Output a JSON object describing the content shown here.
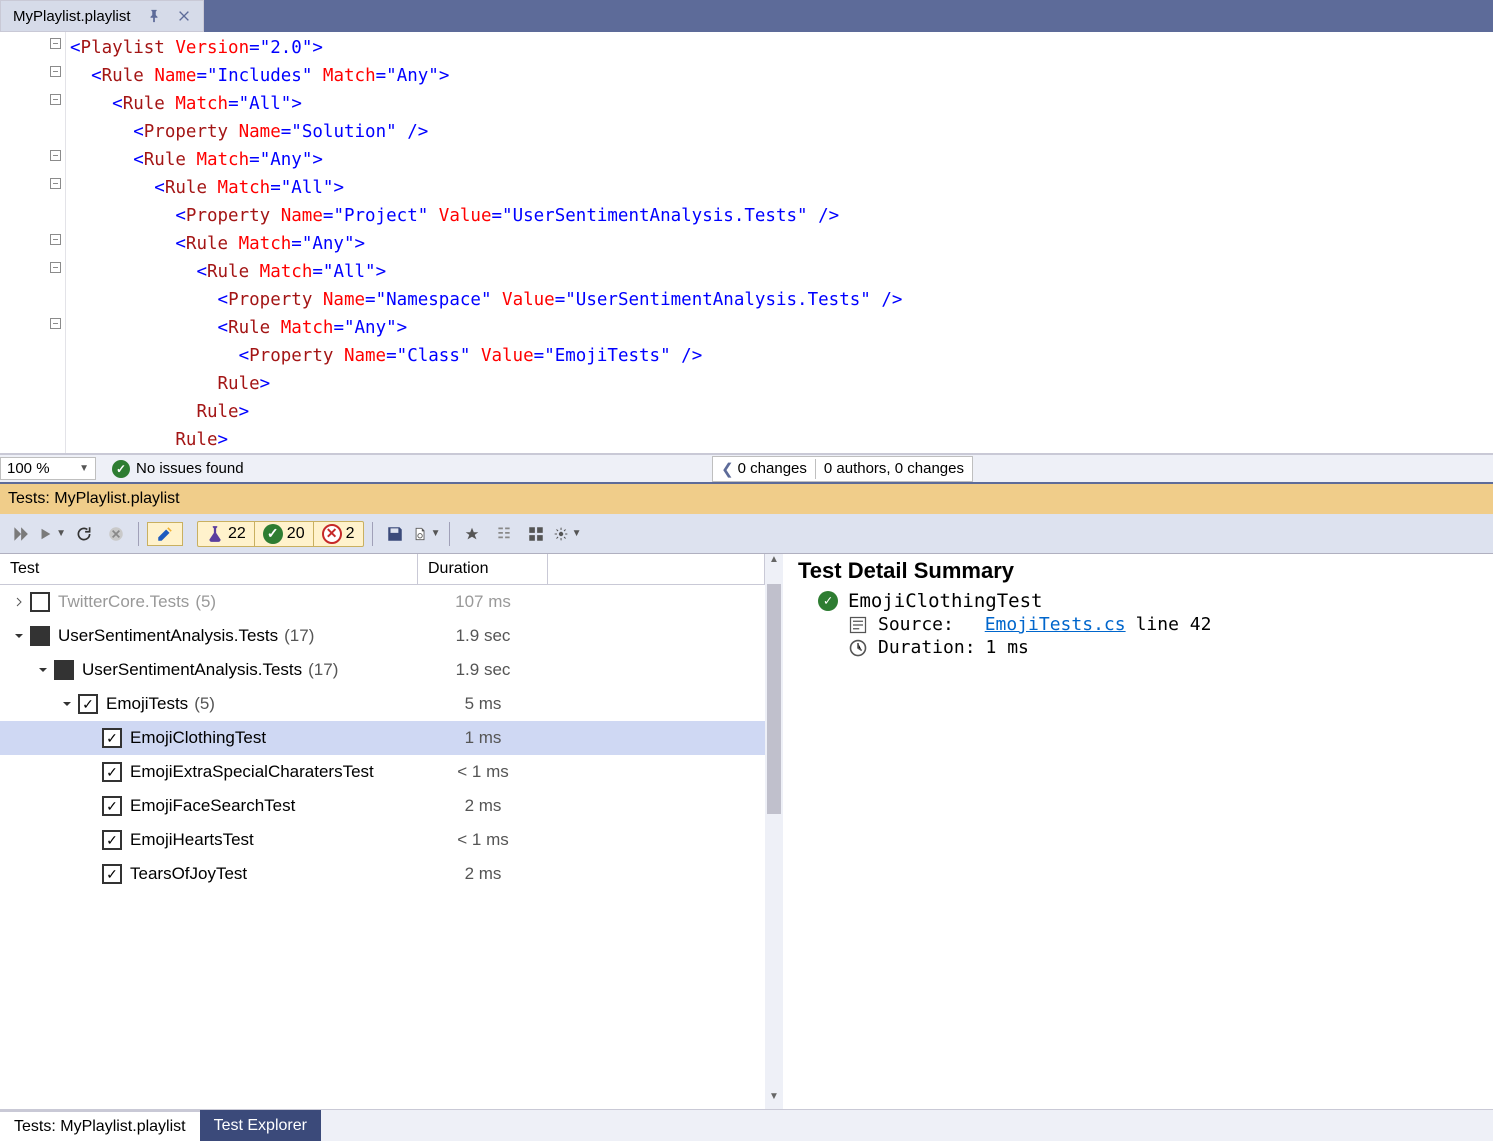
{
  "tab": {
    "title": "MyPlaylist.playlist"
  },
  "code": {
    "lines": [
      {
        "indent": 0,
        "parts": [
          {
            "t": "punc",
            "v": "<"
          },
          {
            "t": "tag",
            "v": "Playlist "
          },
          {
            "t": "attr",
            "v": "Version"
          },
          {
            "t": "punc",
            "v": "="
          },
          {
            "t": "val",
            "v": "\"2.0\""
          },
          {
            "t": "punc",
            "v": ">"
          }
        ]
      },
      {
        "indent": 1,
        "parts": [
          {
            "t": "punc",
            "v": "<"
          },
          {
            "t": "tag",
            "v": "Rule "
          },
          {
            "t": "attr",
            "v": "Name"
          },
          {
            "t": "punc",
            "v": "="
          },
          {
            "t": "val",
            "v": "\"Includes\" "
          },
          {
            "t": "attr",
            "v": "Match"
          },
          {
            "t": "punc",
            "v": "="
          },
          {
            "t": "val",
            "v": "\"Any\""
          },
          {
            "t": "punc",
            "v": ">"
          }
        ]
      },
      {
        "indent": 2,
        "parts": [
          {
            "t": "punc",
            "v": "<"
          },
          {
            "t": "tag",
            "v": "Rule "
          },
          {
            "t": "attr",
            "v": "Match"
          },
          {
            "t": "punc",
            "v": "="
          },
          {
            "t": "val",
            "v": "\"All\""
          },
          {
            "t": "punc",
            "v": ">"
          }
        ]
      },
      {
        "indent": 3,
        "parts": [
          {
            "t": "punc",
            "v": "<"
          },
          {
            "t": "tag",
            "v": "Property "
          },
          {
            "t": "attr",
            "v": "Name"
          },
          {
            "t": "punc",
            "v": "="
          },
          {
            "t": "val",
            "v": "\"Solution\" "
          },
          {
            "t": "punc",
            "v": "/>"
          }
        ]
      },
      {
        "indent": 3,
        "parts": [
          {
            "t": "punc",
            "v": "<"
          },
          {
            "t": "tag",
            "v": "Rule "
          },
          {
            "t": "attr",
            "v": "Match"
          },
          {
            "t": "punc",
            "v": "="
          },
          {
            "t": "val",
            "v": "\"Any\""
          },
          {
            "t": "punc",
            "v": ">"
          }
        ]
      },
      {
        "indent": 4,
        "parts": [
          {
            "t": "punc",
            "v": "<"
          },
          {
            "t": "tag",
            "v": "Rule "
          },
          {
            "t": "attr",
            "v": "Match"
          },
          {
            "t": "punc",
            "v": "="
          },
          {
            "t": "val",
            "v": "\"All\""
          },
          {
            "t": "punc",
            "v": ">"
          }
        ]
      },
      {
        "indent": 5,
        "parts": [
          {
            "t": "punc",
            "v": "<"
          },
          {
            "t": "tag",
            "v": "Property "
          },
          {
            "t": "attr",
            "v": "Name"
          },
          {
            "t": "punc",
            "v": "="
          },
          {
            "t": "val",
            "v": "\"Project\" "
          },
          {
            "t": "attr",
            "v": "Value"
          },
          {
            "t": "punc",
            "v": "="
          },
          {
            "t": "val",
            "v": "\"UserSentimentAnalysis.Tests\" "
          },
          {
            "t": "punc",
            "v": "/>"
          }
        ]
      },
      {
        "indent": 5,
        "parts": [
          {
            "t": "punc",
            "v": "<"
          },
          {
            "t": "tag",
            "v": "Rule "
          },
          {
            "t": "attr",
            "v": "Match"
          },
          {
            "t": "punc",
            "v": "="
          },
          {
            "t": "val",
            "v": "\"Any\""
          },
          {
            "t": "punc",
            "v": ">"
          }
        ]
      },
      {
        "indent": 6,
        "parts": [
          {
            "t": "punc",
            "v": "<"
          },
          {
            "t": "tag",
            "v": "Rule "
          },
          {
            "t": "attr",
            "v": "Match"
          },
          {
            "t": "punc",
            "v": "="
          },
          {
            "t": "val",
            "v": "\"All\""
          },
          {
            "t": "punc",
            "v": ">"
          }
        ]
      },
      {
        "indent": 7,
        "parts": [
          {
            "t": "punc",
            "v": "<"
          },
          {
            "t": "tag",
            "v": "Property "
          },
          {
            "t": "attr",
            "v": "Name"
          },
          {
            "t": "punc",
            "v": "="
          },
          {
            "t": "val",
            "v": "\"Namespace\" "
          },
          {
            "t": "attr",
            "v": "Value"
          },
          {
            "t": "punc",
            "v": "="
          },
          {
            "t": "val",
            "v": "\"UserSentimentAnalysis.Tests\" "
          },
          {
            "t": "punc",
            "v": "/>"
          }
        ]
      },
      {
        "indent": 7,
        "parts": [
          {
            "t": "punc",
            "v": "<"
          },
          {
            "t": "tag",
            "v": "Rule "
          },
          {
            "t": "attr",
            "v": "Match"
          },
          {
            "t": "punc",
            "v": "="
          },
          {
            "t": "val",
            "v": "\"Any\""
          },
          {
            "t": "punc",
            "v": ">"
          }
        ]
      },
      {
        "indent": 8,
        "parts": [
          {
            "t": "punc",
            "v": "<"
          },
          {
            "t": "tag",
            "v": "Property "
          },
          {
            "t": "attr",
            "v": "Name"
          },
          {
            "t": "punc",
            "v": "="
          },
          {
            "t": "val",
            "v": "\"Class\" "
          },
          {
            "t": "attr",
            "v": "Value"
          },
          {
            "t": "punc",
            "v": "="
          },
          {
            "t": "val",
            "v": "\"EmojiTests\" "
          },
          {
            "t": "punc",
            "v": "/>"
          }
        ]
      },
      {
        "indent": 7,
        "parts": [
          {
            "t": "punc",
            "v": "</"
          },
          {
            "t": "tag",
            "v": "Rule"
          },
          {
            "t": "punc",
            "v": ">"
          }
        ]
      },
      {
        "indent": 6,
        "parts": [
          {
            "t": "punc",
            "v": "</"
          },
          {
            "t": "tag",
            "v": "Rule"
          },
          {
            "t": "punc",
            "v": ">"
          }
        ]
      },
      {
        "indent": 5,
        "parts": [
          {
            "t": "punc",
            "v": "</"
          },
          {
            "t": "tag",
            "v": "Rule"
          },
          {
            "t": "punc",
            "v": ">"
          }
        ]
      }
    ]
  },
  "status": {
    "zoom": "100 %",
    "issues": "No issues found",
    "changes": "0 changes",
    "authors": "0 authors, 0 changes"
  },
  "tests_header": "Tests: MyPlaylist.playlist",
  "toolbar": {
    "total": "22",
    "passed": "20",
    "failed": "2"
  },
  "tree": {
    "headers": {
      "test": "Test",
      "duration": "Duration"
    },
    "rows": [
      {
        "level": 0,
        "expand": "right",
        "check": "empty",
        "name": "TwitterCore.Tests",
        "count": "(5)",
        "duration": "107 ms",
        "dim": true
      },
      {
        "level": 0,
        "expand": "down",
        "check": "filled",
        "name": "UserSentimentAnalysis.Tests",
        "count": "(17)",
        "duration": "1.9 sec"
      },
      {
        "level": 1,
        "expand": "down",
        "check": "filled",
        "name": "UserSentimentAnalysis.Tests",
        "count": "(17)",
        "duration": "1.9 sec"
      },
      {
        "level": 2,
        "expand": "down",
        "check": "checked",
        "name": "EmojiTests",
        "count": "(5)",
        "duration": "5 ms"
      },
      {
        "level": 3,
        "expand": "",
        "check": "checked",
        "name": "EmojiClothingTest",
        "count": "",
        "duration": "1 ms",
        "selected": true
      },
      {
        "level": 3,
        "expand": "",
        "check": "checked",
        "name": "EmojiExtraSpecialCharatersTest",
        "count": "",
        "duration": "< 1 ms"
      },
      {
        "level": 3,
        "expand": "",
        "check": "checked",
        "name": "EmojiFaceSearchTest",
        "count": "",
        "duration": "2 ms"
      },
      {
        "level": 3,
        "expand": "",
        "check": "checked",
        "name": "EmojiHeartsTest",
        "count": "",
        "duration": "< 1 ms"
      },
      {
        "level": 3,
        "expand": "",
        "check": "checked",
        "name": "TearsOfJoyTest",
        "count": "",
        "duration": "2 ms"
      }
    ]
  },
  "detail": {
    "title": "Test Detail Summary",
    "test_name": "EmojiClothingTest",
    "source_label": "Source:",
    "source_file": "EmojiTests.cs",
    "source_line": "line 42",
    "duration_label": "Duration:",
    "duration_value": "1 ms"
  },
  "bottom_tabs": {
    "tests": "Tests: MyPlaylist.playlist",
    "explorer": "Test Explorer"
  }
}
